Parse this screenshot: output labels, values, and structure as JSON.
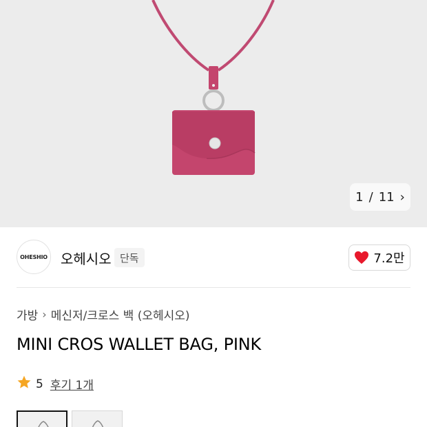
{
  "gallery": {
    "counter_current": "1",
    "counter_separator": "/",
    "counter_total": "11",
    "next_icon": "chevron-right-icon",
    "background_color": "#ececec",
    "product_color": "#c4456d"
  },
  "brand": {
    "logo_text": "OHESHIO",
    "name": "오헤시오",
    "badge": "단독"
  },
  "like": {
    "icon": "heart-icon",
    "icon_color": "#e8192c",
    "count": "7.2만"
  },
  "breadcrumb": {
    "items": [
      "가방",
      "메신저/크로스 백 (오헤시오)"
    ],
    "separator_icon": "chevron-right-icon"
  },
  "product": {
    "title": "MINI CROS WALLET BAG, PINK"
  },
  "rating": {
    "icon": "star-icon",
    "star_color": "#f5a623",
    "score": "5",
    "review_label": "후기 1개"
  }
}
